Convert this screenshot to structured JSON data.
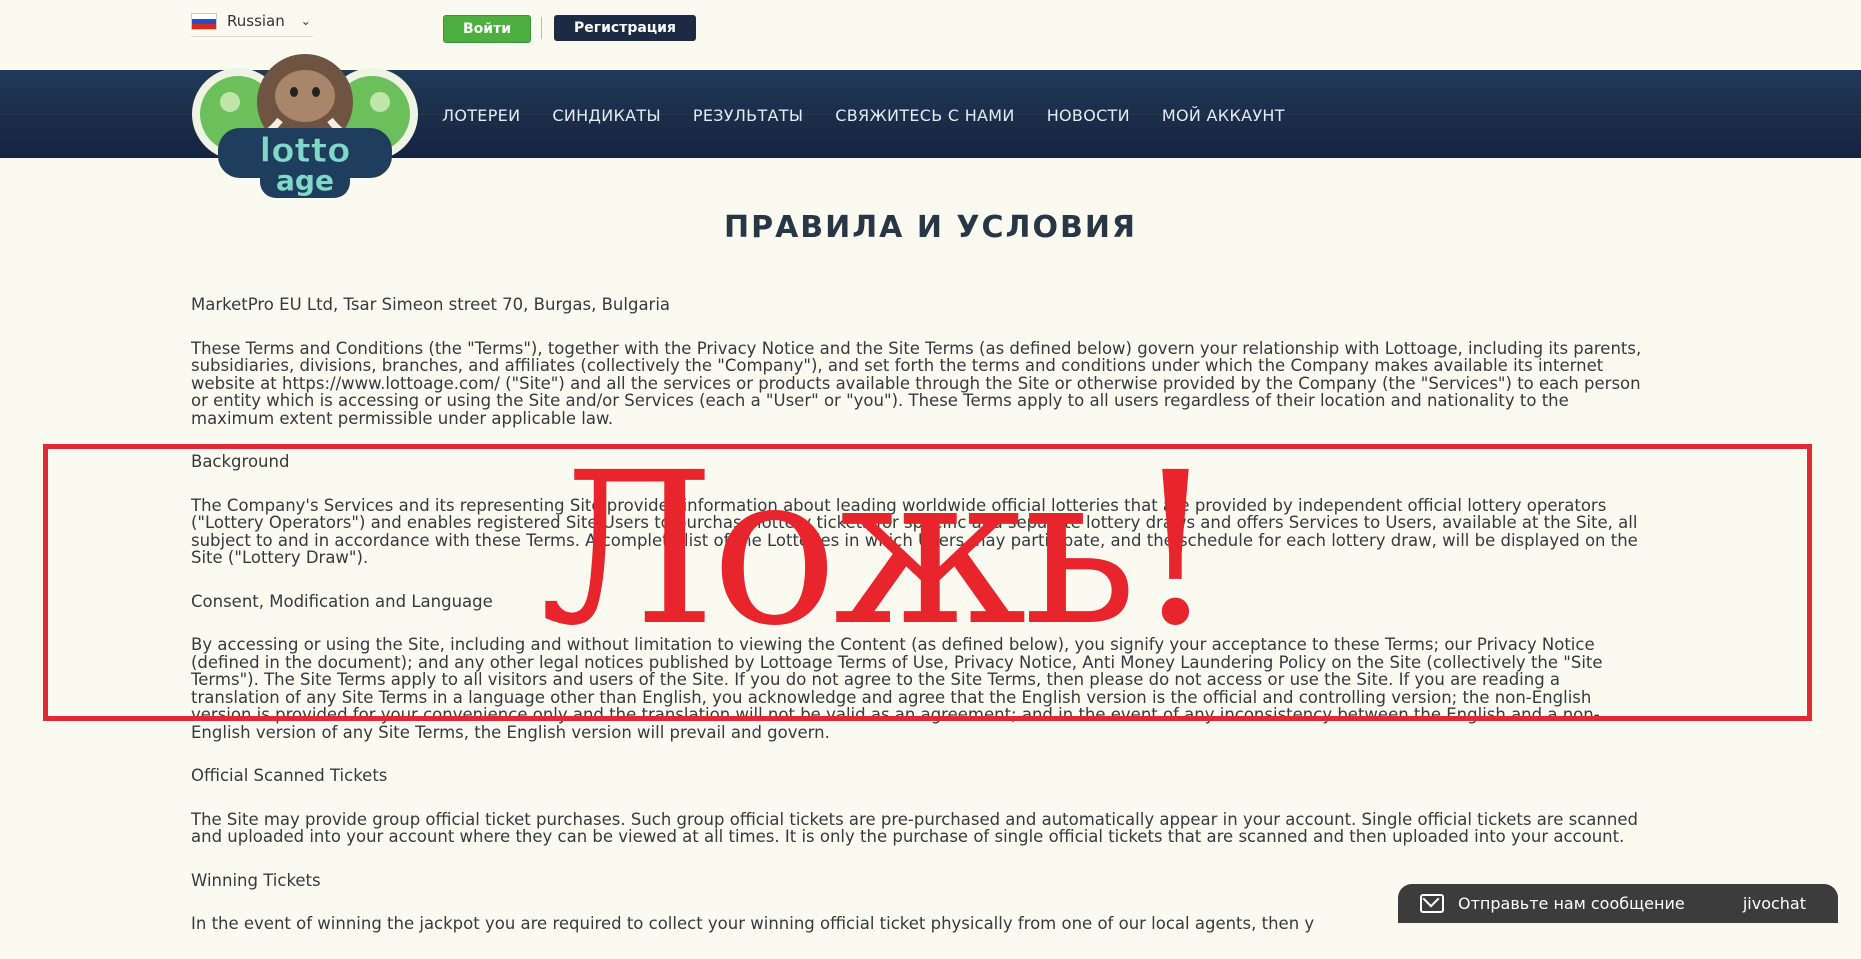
{
  "header": {
    "language": "Russian",
    "login_label": "Войти",
    "register_label": "Регистрация"
  },
  "nav": {
    "items": [
      "ЛОТЕРЕИ",
      "СИНДИКАТЫ",
      "РЕЗУЛЬТАТЫ",
      "СВЯЖИТЕСЬ С НАМИ",
      "НОВОСТИ",
      "МОЙ АККАУНТ"
    ]
  },
  "logo": {
    "text_top": "lotto",
    "text_bottom": "age"
  },
  "page": {
    "title": "ПРАВИЛА И УСЛОВИЯ",
    "address": "MarketPro EU Ltd, Tsar Simeon street 70, Burgas, Bulgaria",
    "intro": "These Terms and Conditions (the \"Terms\"), together with the Privacy Notice and the Site Terms (as defined below) govern your relationship with Lottoage, including its parents, subsidiaries, divisions, branches, and affiliates (collectively the \"Company\"), and set forth the terms and conditions under which the Company makes available its internet website at https://www.lottoage.com/ (\"Site\") and all the services or products available through the Site or otherwise provided by the Company (the \"Services\") to each person or entity which is accessing or using the Site and/or Services (each a \"User\" or \"you\"). These Terms apply to all users regardless of their location and nationality to the maximum extent permissible under applicable law.",
    "h_background": "Background",
    "background": "The Company's Services and its representing Site provides information about leading worldwide official lotteries that are provided by independent official lottery operators (\"Lottery Operators\") and enables registered Site Users to purchase lottery tickets for specific and separate lottery draws and offers Services to Users, available at the Site, all subject to and in accordance with these Terms. A complete list of the Lotteries in which Users may participate, and the schedule for each lottery draw, will be displayed on the Site (\"Lottery Draw\").",
    "h_consent": "Consent, Modification and Language",
    "consent": "By accessing or using the Site, including and without limitation to viewing the Content (as defined below), you signify your acceptance to these Terms; our Privacy Notice (defined in the document); and any other legal notices published by Lottoage Terms of Use, Privacy Notice, Anti Money Laundering Policy on the Site (collectively the \"Site Terms\"). The Site Terms apply to all visitors and users of the Site. If you do not agree to the Site Terms, then please do not access or use the Site. If you are reading a translation of any Site Terms in a language other than English, you acknowledge and agree that the English version is the official and controlling version; the non-English version is provided for your convenience only and the translation will not be valid as an agreement; and in the event of any inconsistency between the English and a non-English version of any Site Terms, the English version will prevail and govern.",
    "h_scanned": "Official Scanned Tickets",
    "scanned": "The Site may provide group official ticket purchases. Such group official tickets are pre-purchased and automatically appear in your account. Single official tickets are scanned and uploaded into your account where they can be viewed at all times. It is only the purchase of single official tickets that are scanned and then uploaded into your account.",
    "h_winning": "Winning Tickets",
    "winning": "In the event of winning the jackpot you are required to collect your winning official ticket physically from one of our local agents, then y"
  },
  "overlay": {
    "stamp": "Ложь!",
    "color": "#e8242c"
  },
  "chat": {
    "message": "Отправьте нам сообщение",
    "brand": "jivochat"
  },
  "colors": {
    "background": "#fbfaf0",
    "nav": "#1b2f4b",
    "login": "#4caf3f",
    "register": "#1c2a44"
  }
}
